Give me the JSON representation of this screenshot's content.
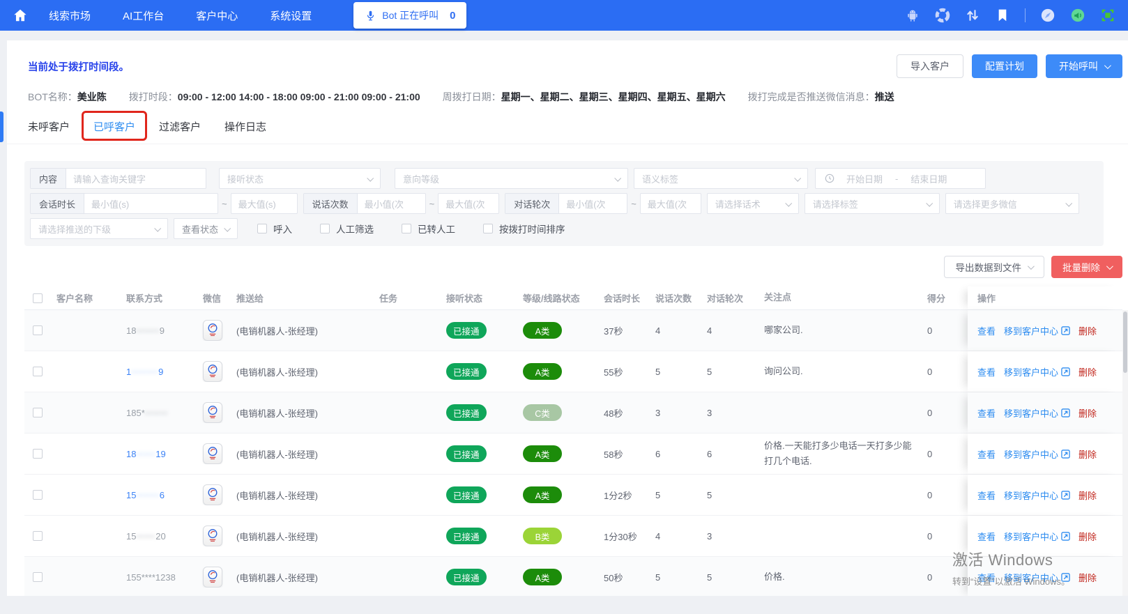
{
  "navbar": {
    "menu": [
      "线索市场",
      "AI工作台",
      "客户中心",
      "系统设置"
    ],
    "bot_button": {
      "label": "Bot 正在呼叫",
      "count": "0"
    },
    "icons": [
      "home-icon",
      "mic-icon",
      "android-icon",
      "shutter-icon",
      "sort-arrows-icon",
      "bookmark-icon",
      "compass-icon",
      "megaphone-icon",
      "fullscreen-icon"
    ]
  },
  "page": {
    "status_text": "当前处于拨打时间段。",
    "import_btn": "导入客户",
    "config_btn": "配置计划",
    "start_btn": "开始呼叫",
    "info": {
      "bot_label": "BOT名称：",
      "bot_value": "美业陈",
      "period_label": "拨打时段：",
      "period_value": "09:00 - 12:00 14:00 - 18:00 09:00 - 21:00 09:00 - 21:00",
      "week_label": "周拨打日期：",
      "week_value": "星期一、星期二、星期三、星期四、星期五、星期六",
      "push_label": "拨打完成是否推送微信消息：",
      "push_value": "推送"
    },
    "tabs": [
      "未呼客户",
      "已呼客户",
      "过滤客户",
      "操作日志"
    ]
  },
  "filters": {
    "content_label": "内容",
    "content_placeholder": "请输入查询关键字",
    "listen_status": "接听状态",
    "intent_level": "意向等级",
    "semantic_tag": "语义标签",
    "start_date": "开始日期",
    "range_sep": "-",
    "end_date": "结束日期",
    "session_label": "会话时长",
    "min_s": "最小值(s)",
    "max_s": "最大值(s)",
    "tilde": "~",
    "talk_label": "说话次数",
    "min_c": "最小值(次",
    "max_c": "最大值(次",
    "round_label": "对话轮次",
    "script_placeholder": "请选择话术",
    "tag_placeholder": "请选择标签",
    "more_wechat_placeholder": "请选择更多微信",
    "push_sub_placeholder": "请选择推送的下级",
    "view_status": "查看状态",
    "checkboxes": [
      "呼入",
      "人工筛选",
      "已转人工",
      "按拨打时间排序"
    ]
  },
  "toolbar": {
    "export": "导出数据到文件",
    "batch_delete": "批量删除"
  },
  "table": {
    "columns": [
      "客户名称",
      "联系方式",
      "微信",
      "推送给",
      "任务",
      "接听状态",
      "等级/线路状态",
      "会话时长",
      "说话次数",
      "对话轮次",
      "关注点",
      "得分",
      "操作"
    ],
    "actions": {
      "view": "查看",
      "move": "移到客户中心",
      "del": "删除"
    },
    "rows": [
      {
        "phone_prefix": "18",
        "phone_mask": "••••••",
        "phone_suffix": "9",
        "linked": "no",
        "pushed_to": "(电销机器人-张经理)",
        "status": "已接通",
        "grade": "A类",
        "grade_key": "a",
        "duration": "37秒",
        "talk_count": "4",
        "dialog_rounds": "4",
        "focus": "哪家公司.",
        "score": "0"
      },
      {
        "phone_prefix": "1",
        "phone_mask": "•••••••",
        "phone_suffix": "9",
        "linked": "yes",
        "pushed_to": "(电销机器人-张经理)",
        "status": "已接通",
        "grade": "A类",
        "grade_key": "a",
        "duration": "55秒",
        "talk_count": "5",
        "dialog_rounds": "5",
        "focus": "询问公司.",
        "score": "0"
      },
      {
        "phone_prefix": "185*",
        "phone_mask": "••••••",
        "phone_suffix": "",
        "linked": "no",
        "pushed_to": "(电销机器人-张经理)",
        "status": "已接通",
        "grade": "C类",
        "grade_key": "c",
        "duration": "48秒",
        "talk_count": "3",
        "dialog_rounds": "3",
        "focus": "",
        "score": "0"
      },
      {
        "phone_prefix": "18",
        "phone_mask": "•••••",
        "phone_suffix": "19",
        "linked": "yes",
        "pushed_to": "(电销机器人-张经理)",
        "status": "已接通",
        "grade": "A类",
        "grade_key": "a",
        "duration": "58秒",
        "talk_count": "6",
        "dialog_rounds": "6",
        "focus": "价格.一天能打多少电话一天打多少能打几个电话.",
        "score": "0"
      },
      {
        "phone_prefix": "15",
        "phone_mask": "••••••",
        "phone_suffix": "6",
        "linked": "yes",
        "pushed_to": "(电销机器人-张经理)",
        "status": "已接通",
        "grade": "A类",
        "grade_key": "a",
        "duration": "1分2秒",
        "talk_count": "5",
        "dialog_rounds": "5",
        "focus": "",
        "score": "0"
      },
      {
        "phone_prefix": "15",
        "phone_mask": "•••••",
        "phone_suffix": "20",
        "linked": "no",
        "pushed_to": "(电销机器人-张经理)",
        "status": "已接通",
        "grade": "B类",
        "grade_key": "b",
        "duration": "1分30秒",
        "talk_count": "4",
        "dialog_rounds": "3",
        "focus": "",
        "score": "0"
      },
      {
        "phone_prefix": "155****1238",
        "phone_mask": "",
        "phone_suffix": "",
        "linked": "no",
        "pushed_to": "(电销机器人-张经理)",
        "status": "已接通",
        "grade": "A类",
        "grade_key": "a",
        "duration": "50秒",
        "talk_count": "5",
        "dialog_rounds": "5",
        "focus": "价格.",
        "score": "0"
      }
    ]
  },
  "watermark": {
    "line1": "激活 Windows",
    "line2": "转到“设置”以激活 Windows。"
  },
  "colors": {
    "navbar": "#2b6df3",
    "primary_link": "#2d8cf0",
    "primary_btn": "#3d8bf8",
    "status_text": "#2742ea",
    "connected_badge": "#0fa65a",
    "grade_a": "#1c8c0a",
    "grade_b": "#9bd437",
    "grade_c": "#a8c7a4",
    "delete_link": "#c1271e",
    "batch_delete_btn": "#f05f5f",
    "annotation_box": "#e0261c"
  }
}
